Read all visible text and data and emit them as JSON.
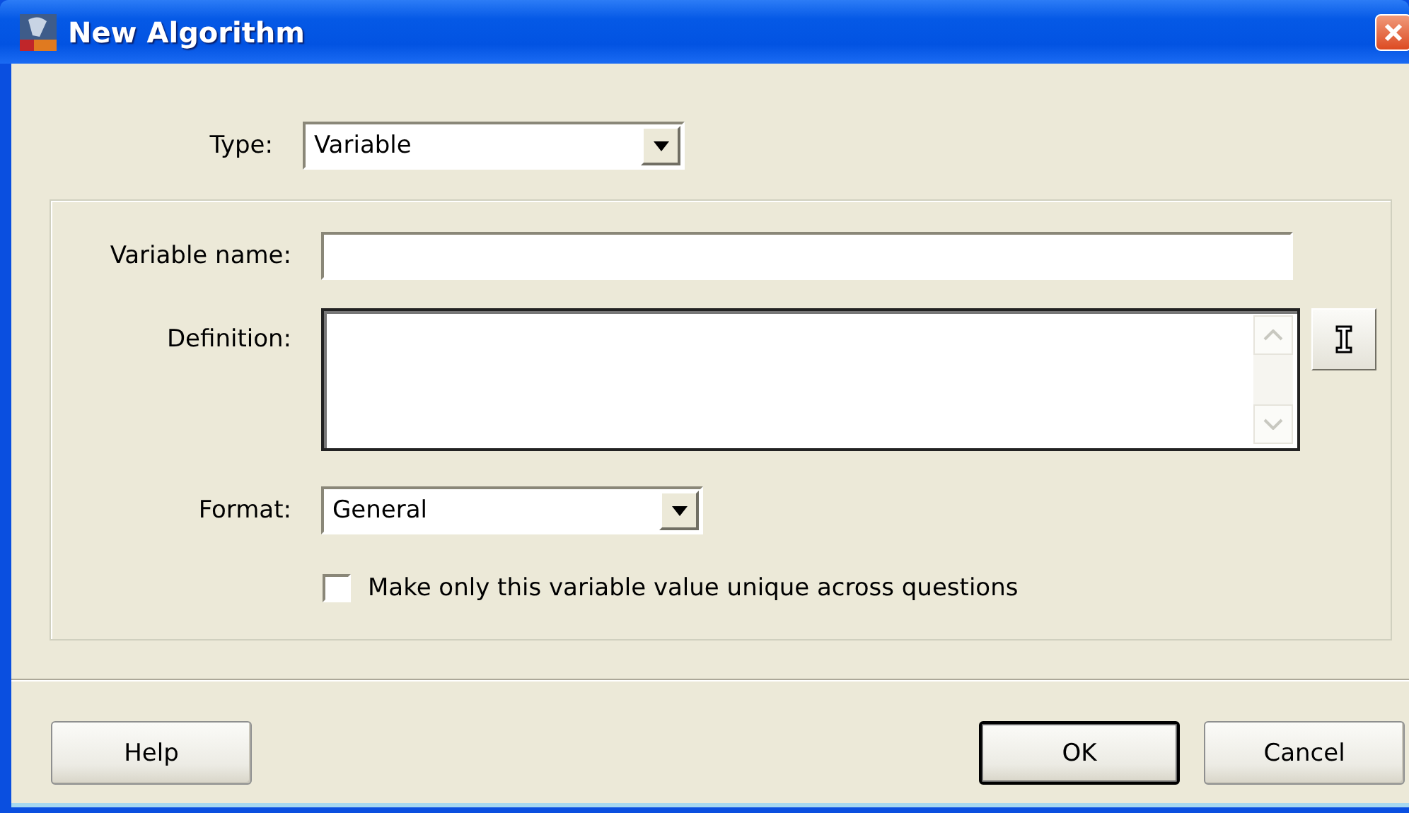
{
  "window": {
    "title": "New Algorithm"
  },
  "type_field": {
    "label": "Type:",
    "value": "Variable"
  },
  "variable_name": {
    "label": "Variable name:"
  },
  "definition": {
    "label": "Definition:"
  },
  "format_field": {
    "label": "Format:",
    "value": "General"
  },
  "unique_option": {
    "label": "Make only this variable value unique across questions",
    "checked": false
  },
  "buttons": [
    {
      "label": "Help",
      "default": false
    },
    {
      "label": "OK",
      "default": true
    },
    {
      "label": "Cancel",
      "default": false
    }
  ]
}
